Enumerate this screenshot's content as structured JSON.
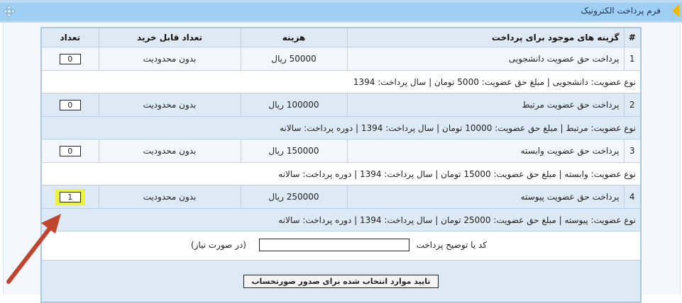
{
  "title_bar": {
    "title": "فرم پرداخت الکترونیک"
  },
  "table": {
    "headers": {
      "hash": "#",
      "option": "گزینه های موجود برای پرداخت",
      "price": "هزینه",
      "limit": "تعداد قابل خرید",
      "qty": "تعداد"
    },
    "rows": [
      {
        "num": "1",
        "title": "پرداخت حق عضویت دانشجویی",
        "price": "50000 ریال",
        "limit": "بدون محدودیت",
        "qty": "0",
        "desc": "نوع عضویت: دانشجویی | مبلغ حق عضویت: 5000 تومان | سال پرداخت: 1394"
      },
      {
        "num": "2",
        "title": "پرداخت حق عضویت مرتبط",
        "price": "100000 ریال",
        "limit": "بدون محدودیت",
        "qty": "0",
        "desc": "نوع عضویت: مرتبط | مبلغ حق عضویت: 10000 تومان | سال پرداخت: 1394 | دوره پرداخت: سالانه"
      },
      {
        "num": "3",
        "title": "پرداخت حق عضویت وابسته",
        "price": "150000 ریال",
        "limit": "بدون محدودیت",
        "qty": "0",
        "desc": "نوع عضویت: وابسته | مبلغ حق عضویت: 15000 تومان | سال پرداخت: 1394 | دوره پرداخت: سالانه"
      },
      {
        "num": "4",
        "title": "پرداخت حق عضویت پیوسته",
        "price": "250000 ریال",
        "limit": "بدون محدودیت",
        "qty": "1",
        "desc": "نوع عضویت: پیوسته | مبلغ حق عضویت: 25000 تومان | سال پرداخت: 1394 | دوره پرداخت: سالانه"
      }
    ],
    "code_label": "کد یا توضیح پرداخت",
    "code_value": "",
    "code_hint": "(در صورت نیاز)",
    "submit_label": "تایید موارد انتخاب شده برای صدور صورتحساب"
  },
  "colors": {
    "highlight": "#eef33a",
    "arrow": "#c0452f",
    "header_bg": "#dfe9f4"
  }
}
